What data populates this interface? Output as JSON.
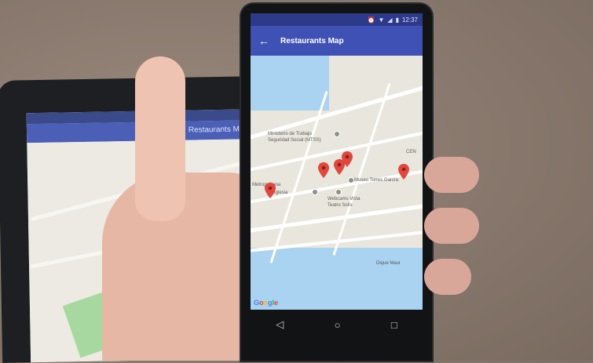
{
  "status_bar": {
    "time": "12:37",
    "icons": [
      "alarm-icon",
      "wifi-icon",
      "signal-icon",
      "battery-icon"
    ]
  },
  "app_bar": {
    "title": "Restaurants Map",
    "back_icon": "arrow-back-icon"
  },
  "map": {
    "labels": {
      "ministerio_line1": "Ministerio de Trabajo",
      "ministerio_line2": "Seguridad Social (MTSS)",
      "museo": "Museo Torres García",
      "metropolitana": "Metropolitana",
      "iglesia": "Iglesia",
      "teatro_line1": "Webcams Vista",
      "teatro_line2": "Teatro Solís",
      "cen": "CEN",
      "dique": "Dique Maui"
    },
    "marker_count": 5,
    "marker_color": "#e0473d",
    "attribution": [
      "G",
      "o",
      "o",
      "g",
      "l",
      "e"
    ]
  },
  "tablet": {
    "app_title": "Restaurants Map"
  },
  "nav_bar": {
    "back": "◁",
    "home": "○",
    "recents": "□"
  }
}
